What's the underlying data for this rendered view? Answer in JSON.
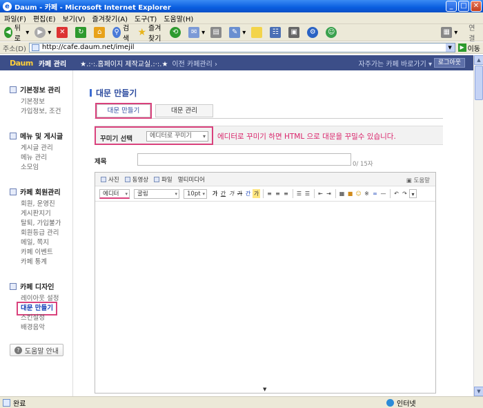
{
  "window": {
    "title": "Daum - 카페 - Microsoft Internet Explorer",
    "min": "_",
    "max": "□",
    "close": "✕"
  },
  "menu": [
    "파일(F)",
    "편집(E)",
    "보기(V)",
    "즐겨찾기(A)",
    "도구(T)",
    "도움말(H)"
  ],
  "toolbar": {
    "back": "뒤로",
    "search": "검색",
    "favorites": "즐겨찾기",
    "connect": "연결"
  },
  "address": {
    "label": "주소(D)",
    "url": "http://cafe.daum.net/imejil",
    "go": "이동"
  },
  "cafe": {
    "logo": "Daum",
    "mgmt": "카페 관리",
    "name": "★.:·:.홈페이지 제작교실.:·:.★",
    "prev": "이전 카페관리 ›",
    "shortcut": "자주가는 카페 바로가기 ▾",
    "logout": "로그아웃"
  },
  "sidebar": {
    "groups": [
      {
        "title": "기본정보 관리",
        "items": [
          "기본정보",
          "가입정보, 조건"
        ]
      },
      {
        "title": "메뉴 및 게시글",
        "items": [
          "게시글 관리",
          "메뉴 관리",
          "소모임"
        ]
      },
      {
        "title": "카페 회원관리",
        "items": [
          "회원, 운영진",
          "게시판지기",
          "탈퇴, 가입불가",
          "회원등급 관리",
          "메일, 쪽지",
          "카페 이벤트",
          "카페 통계"
        ]
      },
      {
        "title": "카페 디자인",
        "items": [
          "레이아웃 설정",
          "대문 만들기",
          "스킨설정",
          "배경음악"
        ]
      }
    ],
    "help": "도움말 안내"
  },
  "main": {
    "title": "대문 만들기",
    "tabs": [
      "대문 만들기",
      "대문 관리"
    ],
    "decor_label": "꾸미기 선택",
    "decor_value": "에디터로 꾸미기",
    "note": "에디터로 꾸미기 하면 HTML 으로 대문을 꾸밀수 있습니다.",
    "subject_label": "제목",
    "subject_count": "0/ 15자",
    "editor": {
      "attach": [
        "사진",
        "동영상",
        "파일",
        "멀티미디어"
      ],
      "help": "도움말",
      "mode": "에디터",
      "font": "굴림",
      "size": "10pt",
      "format": [
        "가",
        "간",
        "가",
        "가",
        "간",
        "가"
      ]
    }
  },
  "status": {
    "done": "완료",
    "zone": "인터넷"
  }
}
